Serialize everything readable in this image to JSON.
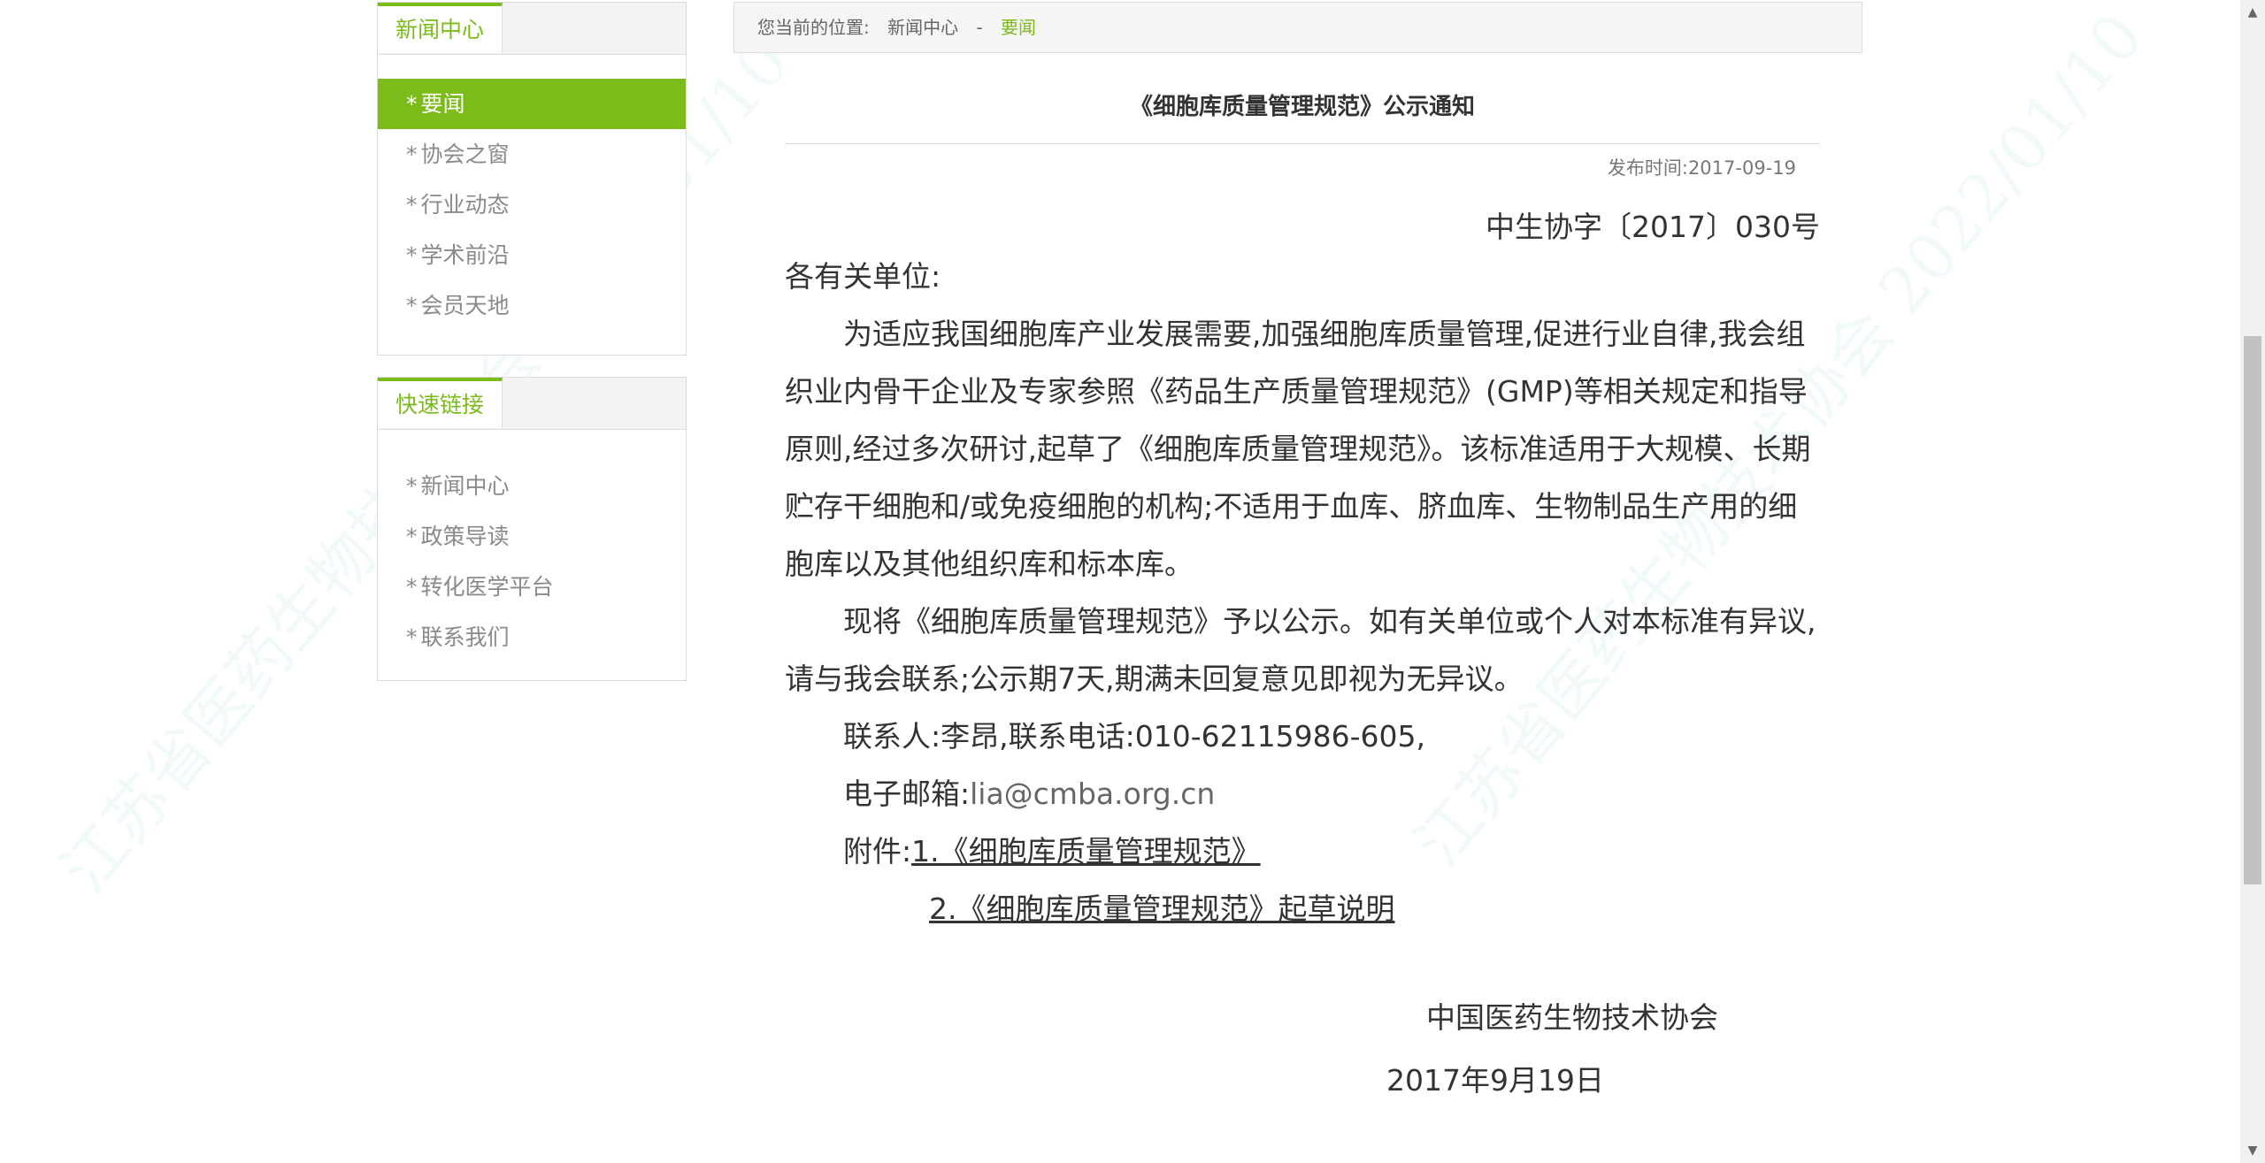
{
  "watermark": "江苏省医药生物技术协会 2022/01/10",
  "sidebar": {
    "news": {
      "title": "新闻中心",
      "items": [
        {
          "label": "要闻",
          "active": true
        },
        {
          "label": "协会之窗"
        },
        {
          "label": "行业动态"
        },
        {
          "label": "学术前沿"
        },
        {
          "label": "会员天地"
        }
      ]
    },
    "links": {
      "title": "快速链接",
      "items": [
        {
          "label": "新闻中心"
        },
        {
          "label": "政策导读"
        },
        {
          "label": "转化医学平台"
        },
        {
          "label": "联系我们"
        }
      ]
    }
  },
  "breadcrumb": {
    "prefix": "您当前的位置:",
    "section": "新闻中心",
    "separator": "-",
    "current": "要闻"
  },
  "article": {
    "title": "《细胞库质量管理规范》公示通知",
    "published": "发布时间:2017-09-19",
    "doc_no": "中生协字〔2017〕030号",
    "salutation": "各有关单位:",
    "p1": "为适应我国细胞库产业发展需要,加强细胞库质量管理,促进行业自律,我会组织业内骨干企业及专家参照《药品生产质量管理规范》(GMP)等相关规定和指导原则,经过多次研讨,起草了《细胞库质量管理规范》。该标准适用于大规模、长期贮存干细胞和/或免疫细胞的机构;不适用于血库、脐血库、生物制品生产用的细胞库以及其他组织库和标本库。",
    "p2": "现将《细胞库质量管理规范》予以公示。如有关单位或个人对本标准有异议,请与我会联系;公示期7天,期满未回复意见即视为无异议。",
    "contact": "联系人:李昂,联系电话:010-62115986-605,",
    "email_label": "电子邮箱:",
    "email": "lia@cmba.org.cn",
    "attach_label": "附件:",
    "attach1": "1.《细胞库质量管理规范》",
    "attach2": "2.《细胞库质量管理规范》起草说明",
    "sign_org": "中国医药生物技术协会",
    "sign_date": "2017年9月19日"
  },
  "colors": {
    "accent": "#7bbb1a",
    "border": "#dcdcdc"
  }
}
